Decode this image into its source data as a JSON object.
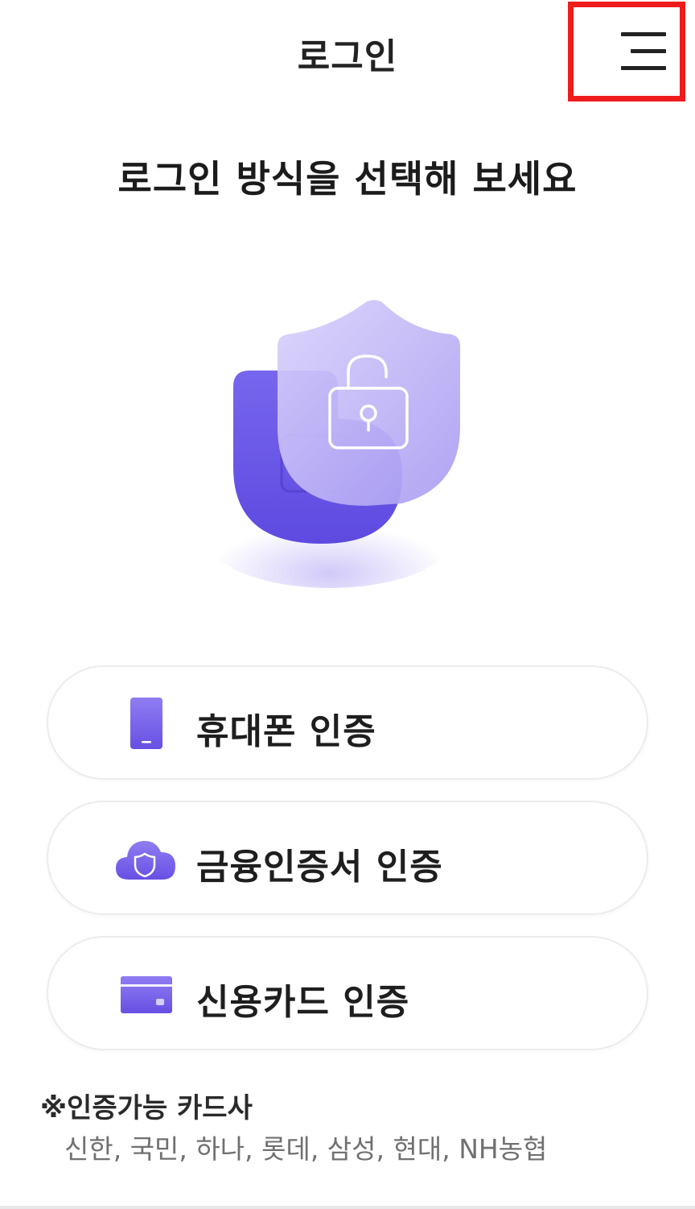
{
  "header": {
    "title": "로그인",
    "menu_icon": "hamburger-menu-icon",
    "highlight_color": "#ee1c1c"
  },
  "headline": "로그인 방식을 선택해 보세요",
  "illustration": {
    "icon": "shield-lock-icon",
    "accent_color": "#6b57e6"
  },
  "login_options": [
    {
      "label": "휴대폰 인증",
      "icon": "phone-icon"
    },
    {
      "label": "금융인증서 인증",
      "icon": "cloud-shield-icon"
    },
    {
      "label": "신용카드 인증",
      "icon": "credit-card-icon"
    }
  ],
  "notice": {
    "title": "※인증가능 카드사",
    "cards": "신한, 국민, 하나, 롯데, 삼성, 현대, NH농협"
  }
}
